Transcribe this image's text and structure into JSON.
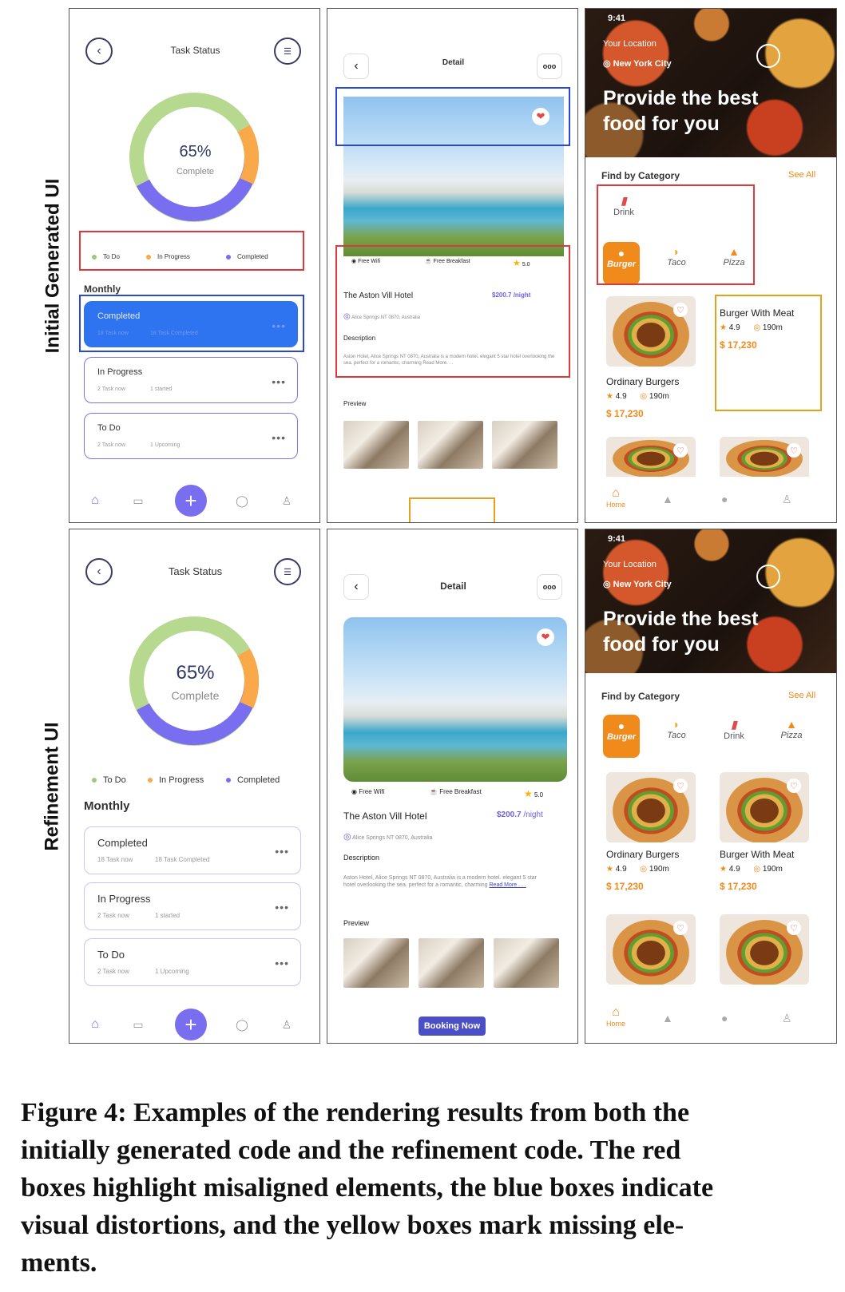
{
  "row_labels": {
    "top": "Initial Generated UI",
    "bottom": "Refinement UI"
  },
  "task": {
    "title": "Task Status",
    "percent": "65%",
    "percent_label": "Complete",
    "progress": 0.65,
    "legend": [
      "To Do",
      "In Progress",
      "Completed"
    ],
    "section": "Monthly",
    "cards": [
      {
        "title": "Completed",
        "a": "18 Task now",
        "b": "18 Task Completed",
        "more": "•••"
      },
      {
        "title": "In Progress",
        "a": "2 Task now",
        "b": "1 started",
        "more": "•••"
      },
      {
        "title": "To Do",
        "a": "2 Task now",
        "b": "1 Upcoming",
        "more": "•••"
      }
    ],
    "fab": "+"
  },
  "hotel": {
    "title": "Detail",
    "more": "ooo",
    "amenities": [
      "Free Wifi",
      "Free Breakfast",
      "5.0"
    ],
    "name": "The Aston Vill Hotel",
    "price": "$200.7",
    "price_unit": "/night",
    "price_initial": "$200.7 /night",
    "address": "Alice Springs NT 0870, Australia",
    "desc_title": "Description",
    "desc": "Aston Hotel, Alice Springs NT 0870, Australia is a modern hotel. elegant 5 star hotel overlooking the sea. perfect for a romantic, charming",
    "desc_initial": "Aston Hotel, Alice Springs NT 0870, Australia is a modern hotel. elegant 5 star hotel overlooking the sea. perfect for a romantic, charming Read More. . .",
    "read_more": "Read More . . .",
    "preview": "Preview",
    "booking": "Booking Now"
  },
  "food": {
    "time": "9:41",
    "location_label": "Your Location",
    "city": "New York City",
    "headline_1": "Provide the best",
    "headline_2": "food for you",
    "category_title": "Find by Category",
    "see_all": "See All",
    "cats_initial": [
      "Drink",
      "Burger",
      "Taco",
      "Pizza"
    ],
    "cats_refined": [
      "Burger",
      "Taco",
      "Drink",
      "Pizza"
    ],
    "items": [
      {
        "name": "Ordinary Burgers",
        "rating": "4.9",
        "dist": "190m",
        "price": "$ 17,230"
      },
      {
        "name": "Burger With Meat",
        "rating": "4.9",
        "dist": "190m",
        "price": "$ 17,230"
      }
    ],
    "home": "Home"
  },
  "caption": {
    "line1": "Figure 4: Examples of the rendering results from both the",
    "line2": "initially generated code and the refinement code. The red",
    "line3": "boxes highlight misaligned elements, the blue boxes indicate",
    "line4": "visual distortions, and the yellow boxes mark missing ele-",
    "line5": "ments."
  },
  "colors": {
    "accent": "#7a6ef0",
    "orange": "#f08a1a",
    "red_box": "#e0393b",
    "blue_box": "#2a46e0",
    "yellow_box": "#e3a21a"
  }
}
